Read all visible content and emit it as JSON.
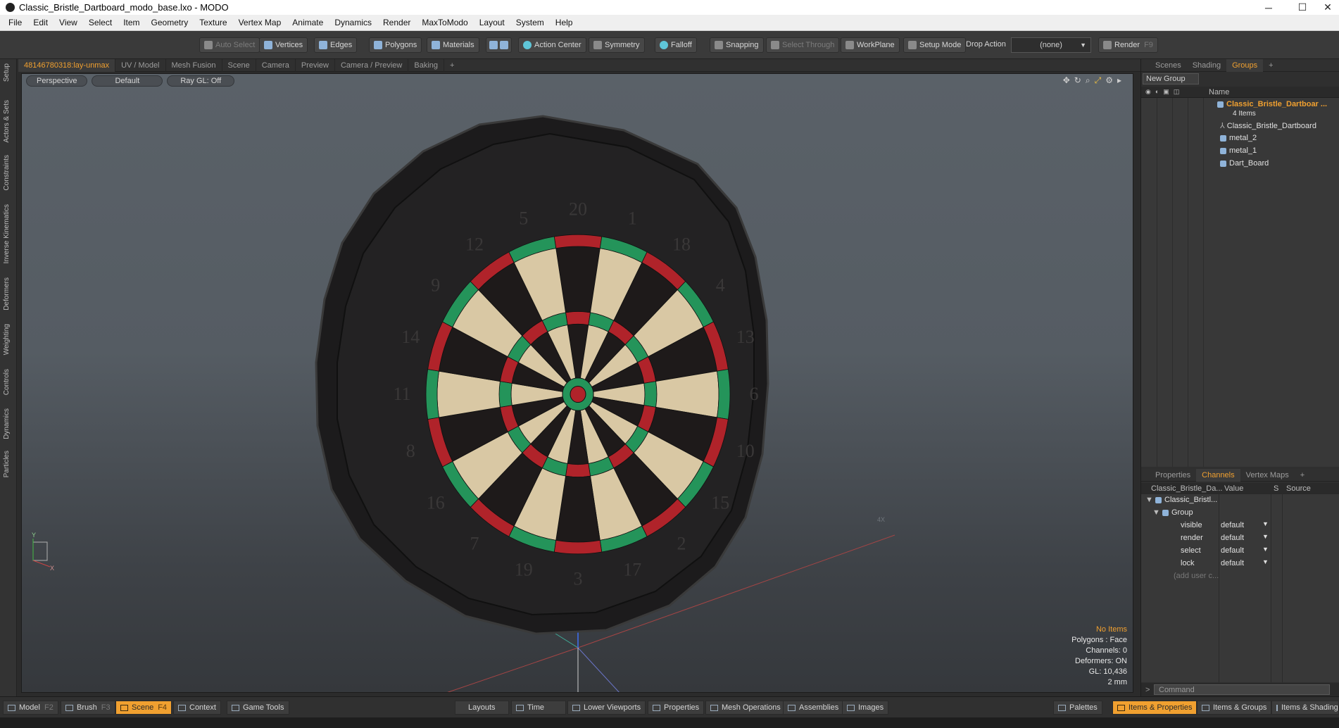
{
  "window": {
    "title": "Classic_Bristle_Dartboard_modo_base.lxo - MODO",
    "minimize": "─",
    "maximize": "☐",
    "close": "✕"
  },
  "menu": [
    "File",
    "Edit",
    "View",
    "Select",
    "Item",
    "Geometry",
    "Texture",
    "Vertex Map",
    "Animate",
    "Dynamics",
    "Render",
    "MaxToModo",
    "Layout",
    "System",
    "Help"
  ],
  "toolbar": {
    "auto_select": "Auto Select",
    "vertices": "Vertices",
    "edges": "Edges",
    "polygons": "Polygons",
    "materials": "Materials",
    "action_center": "Action Center",
    "symmetry": "Symmetry",
    "falloff": "Falloff",
    "snapping": "Snapping",
    "select_through": "Select Through",
    "workplane": "WorkPlane",
    "setup_mode": "Setup Mode",
    "drop_action": "Drop Action",
    "drop_action_value": "(none)",
    "render": "Render",
    "render_key": "F9"
  },
  "left_tabs": [
    "Setup",
    "Actors & Sets",
    "Constraints",
    "Inverse Kinematics",
    "Deformers",
    "Weighting",
    "Controls",
    "Dynamics",
    "Particles"
  ],
  "viewport_tabs": [
    "48146780318:lay-unmax",
    "UV / Model",
    "Mesh Fusion",
    "Scene",
    "Camera",
    "Preview",
    "Camera / Preview",
    "Baking",
    "+"
  ],
  "viewport": {
    "view_mode": "Perspective",
    "shading": "Default",
    "raygl": "Ray GL: Off",
    "info": {
      "no_items": "No Items",
      "polygons": "Polygons : Face",
      "channels": "Channels: 0",
      "deformers": "Deformers: ON",
      "gl": "GL: 10,436",
      "scale": "2 mm"
    },
    "axis_y": "Y",
    "axis_x": "X",
    "grid_label": "4X"
  },
  "right_panel": {
    "top_tabs": [
      "Scenes",
      "Shading",
      "Groups",
      "+"
    ],
    "new_group": "New Group",
    "tree_header_name": "Name",
    "group_name": "Classic_Bristle_Dartboar ...",
    "group_count": "4 Items",
    "items": [
      "Classic_Bristle_Dartboard",
      "metal_2",
      "metal_1",
      "Dart_Board"
    ],
    "bottom_tabs": [
      "Properties",
      "Channels",
      "Vertex Maps",
      "+"
    ],
    "channels_head": {
      "name": "Classic_Bristle_Da...",
      "value": "Value",
      "s": "S",
      "source": "Source"
    },
    "channel_root": "Classic_Bristl...",
    "channel_group": "Group",
    "channels": [
      {
        "name": "visible",
        "value": "default"
      },
      {
        "name": "render",
        "value": "default"
      },
      {
        "name": "select",
        "value": "default"
      },
      {
        "name": "lock",
        "value": "default"
      }
    ],
    "add_user": "(add user c...",
    "command_placeholder": "Command"
  },
  "bottom_bar": {
    "model": "Model",
    "model_key": "F2",
    "brush": "Brush",
    "brush_key": "F3",
    "scene": "Scene",
    "scene_key": "F4",
    "context": "Context",
    "game_tools": "Game Tools",
    "layouts": "Layouts",
    "time": "Time",
    "lower_viewports": "Lower Viewports",
    "properties": "Properties",
    "mesh_operations": "Mesh Operations",
    "assemblies": "Assemblies",
    "images": "Images",
    "palettes": "Palettes",
    "items_properties": "Items & Properties",
    "items_groups": "Items & Groups",
    "items_shading": "Items & Shading"
  },
  "board_numbers": [
    "20",
    "1",
    "18",
    "4",
    "13",
    "6",
    "10",
    "15",
    "2",
    "17",
    "3",
    "19",
    "7",
    "16",
    "8",
    "11",
    "14",
    "9",
    "12",
    "5"
  ],
  "colors": {
    "accent": "#f0a030",
    "board_black": "#1e1a1a",
    "board_cream": "#d9c8a4",
    "ring_red": "#b0232a",
    "ring_green": "#24945a"
  }
}
